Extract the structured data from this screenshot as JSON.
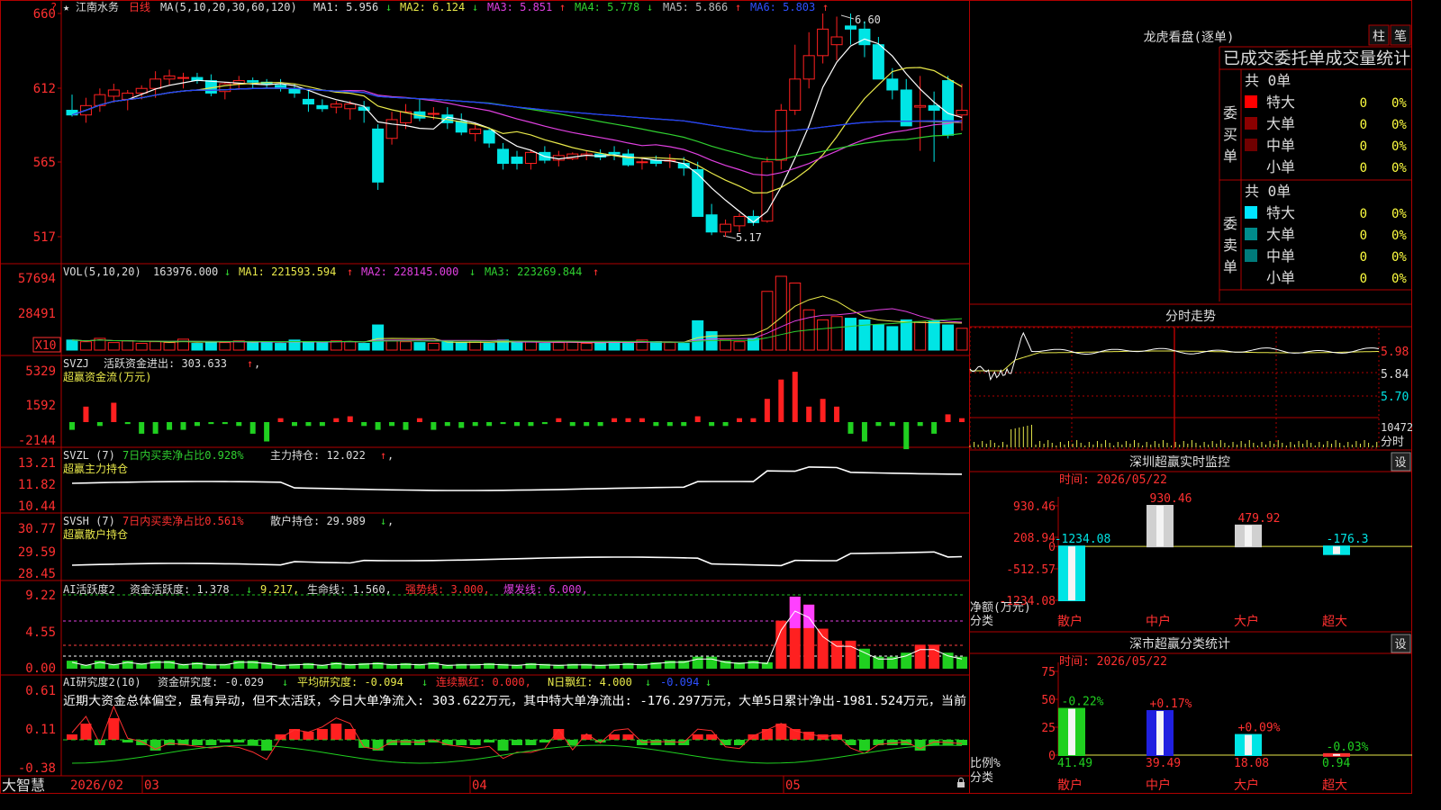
{
  "colors": {
    "up": "#ff2020",
    "down": "#00e5e5",
    "frame": "#b00000",
    "text": "#dcdcdc",
    "ma1": "#ffffff",
    "ma2": "#e8e84a",
    "ma3": "#e040e0",
    "ma4": "#30d030",
    "ma5": "#8c8c8c",
    "ma6": "#2040ff"
  },
  "main": {
    "icon": "star-icon",
    "star": "★",
    "name": "江南水务",
    "period": "日线",
    "ma_title": "MA(5,10,20,30,60,120)",
    "ma1": "MA1: 5.956",
    "ma1_arrow": "↓",
    "ma2": "MA2: 6.124",
    "ma2_arrow": "↓",
    "ma3": "MA3: 5.851",
    "ma3_arrow": "↑",
    "ma4": "MA4: 5.778",
    "ma4_arrow": "↓",
    "ma5": "MA5: 5.866",
    "ma5_arrow": "↑",
    "ma6": "MA6: 5.803",
    "ma6_arrow": "↑",
    "high_label": "6.60",
    "low_label": "5.17",
    "y_ticks": [
      "660",
      "612",
      "565",
      "517"
    ],
    "corner_marker": "?"
  },
  "vol": {
    "title": "VOL(5,10,20)",
    "value": "163976.000",
    "value_arrow": "↓",
    "ma1": "MA1: 221593.594",
    "ma1_arrow": "↑",
    "ma2": "MA2: 228145.000",
    "ma2_arrow": "↓",
    "ma3": "MA3: 223269.844",
    "ma3_arrow": "↑",
    "y_ticks": [
      "57694",
      "28491"
    ],
    "unit": "X10"
  },
  "svzj": {
    "title": "SVZJ",
    "line": "活跃资金进出: 303.633",
    "arrow": "↑",
    "comma": ",",
    "subtitle": "超赢资金流(万元)",
    "y_ticks": [
      "5329",
      "1592",
      "-2144"
    ]
  },
  "svzl": {
    "title": "SVZL (7)",
    "ratio": "7日内买卖净占比0.928%",
    "hold": "主力持仓: 12.022",
    "arrow": "↑",
    "comma": ",",
    "subtitle": "超赢主力持仓",
    "y_ticks": [
      "13.21",
      "11.82",
      "10.44"
    ]
  },
  "svsh": {
    "title": "SVSH (7)",
    "ratio": "7日内买卖净占比0.561%",
    "hold": "散户持仓: 29.989",
    "arrow": "↓",
    "comma": ",",
    "subtitle": "超赢散户持仓",
    "y_ticks": [
      "30.77",
      "29.59",
      "28.45"
    ]
  },
  "ai": {
    "title": "AI活跃度2",
    "active": "资金活跃度: 1.378",
    "active_arrow": "↓",
    "val2": "9.217,",
    "life": "生命线: 1.560,",
    "strong": "强势线: 3.000,",
    "burst": "爆发线: 6.000,",
    "y_ticks": [
      "9.22",
      "4.55",
      "0.00"
    ]
  },
  "research": {
    "title": "AI研究度2(10)",
    "val": "资金研究度: -0.029",
    "val_arrow": "↓",
    "avg": "平均研究度: -0.094",
    "avg_arrow": "↓",
    "red": "连续飘红: 0.000,",
    "nred": "N日飘红: 4.000",
    "nred_arrow": "↓",
    "last": "-0.094",
    "last_arrow": "↓",
    "comment": "近期大资金总体偏空，虽有异动，但不太活跃，今日大单净流入: 303.622万元，其中特大单净流出: -176.297万元，大单5日累计净出-1981.524万元，当前",
    "y_ticks": [
      "0.61",
      "0.11",
      "-0.38"
    ]
  },
  "xaxis": {
    "brand": "大智慧",
    "labels": [
      "2026/02",
      "03",
      "04",
      "05"
    ]
  },
  "lhb": {
    "title": "龙虎看盘(逐单)",
    "tab1": "柱",
    "tab2": "笔",
    "subtitle": "已成交委托单成交量统计",
    "buy": {
      "side": "委买单",
      "total": "共 0单",
      "rows": [
        {
          "label": "特大",
          "n": "0",
          "pct": "0%",
          "color": "#ff0000"
        },
        {
          "label": "大单",
          "n": "0",
          "pct": "0%",
          "color": "#8b0000"
        },
        {
          "label": "中单",
          "n": "0",
          "pct": "0%",
          "color": "#700000"
        },
        {
          "label": "小单",
          "n": "0",
          "pct": "0%",
          "color": ""
        }
      ]
    },
    "sell": {
      "side": "委卖单",
      "total": "共 0单",
      "rows": [
        {
          "label": "特大",
          "n": "0",
          "pct": "0%",
          "color": "#00e5ff"
        },
        {
          "label": "大单",
          "n": "0",
          "pct": "0%",
          "color": "#008b8b"
        },
        {
          "label": "中单",
          "n": "0",
          "pct": "0%",
          "color": "#007a7a"
        },
        {
          "label": "小单",
          "n": "0",
          "pct": "0%",
          "color": ""
        }
      ]
    }
  },
  "minute": {
    "title": "分时走势",
    "y_ticks": [
      "5.98",
      "5.84",
      "5.70"
    ],
    "vol_tick": "10472",
    "bottom": "分时"
  },
  "monitor": {
    "title": "深圳超赢实时监控",
    "btn": "设",
    "time": "时间: 2026/05/22",
    "y_ticks": [
      "930.46",
      "208.94",
      "0",
      "-512.57",
      "-1234.08"
    ],
    "ylabel": "净额(万元)",
    "xlabel": "分类",
    "chart_data": {
      "type": "bar",
      "categories": [
        "散户",
        "中户",
        "大户",
        "超大"
      ],
      "values": [
        -1234.08,
        930.46,
        479.92,
        -176.3
      ],
      "value_labels": [
        "-1234.08",
        "930.46",
        "479.92",
        "-176.3"
      ],
      "ylim": [
        -1234.08,
        930.46
      ]
    }
  },
  "classify": {
    "title": "深市超赢分类统计",
    "btn": "设",
    "time": "时间: 2026/05/22",
    "y_ticks": [
      "75",
      "50",
      "25",
      "0"
    ],
    "ylabel": "比例%",
    "xlabel": "分类",
    "chart_data": {
      "type": "bar",
      "categories": [
        "散户",
        "中户",
        "大户",
        "超大"
      ],
      "values": [
        41.49,
        39.49,
        18.08,
        0.94
      ],
      "changes": [
        "-0.22%",
        "+0.17%",
        "+0.09%",
        "-0.03%"
      ],
      "value_labels": [
        "41.49",
        "39.49",
        "18.08",
        "0.94"
      ],
      "ylim": [
        0,
        75
      ]
    }
  },
  "kline": {
    "ohlc": [
      [
        598,
        608,
        594,
        595
      ],
      [
        595,
        606,
        590,
        601
      ],
      [
        601,
        612,
        597,
        608
      ],
      [
        607,
        615,
        603,
        611
      ],
      [
        605,
        611,
        598,
        609
      ],
      [
        609,
        614,
        605,
        612
      ],
      [
        612,
        623,
        606,
        618
      ],
      [
        618,
        624,
        614,
        620
      ],
      [
        619,
        622,
        612,
        619
      ],
      [
        619,
        622,
        615,
        617
      ],
      [
        617,
        621,
        607,
        609
      ],
      [
        610,
        616,
        605,
        615
      ],
      [
        615,
        620,
        611,
        617
      ],
      [
        617,
        619,
        612,
        616
      ],
      [
        616,
        618,
        612,
        615
      ],
      [
        614,
        618,
        610,
        612
      ],
      [
        612,
        615,
        606,
        609
      ],
      [
        605,
        611,
        597,
        602
      ],
      [
        601,
        605,
        597,
        599
      ],
      [
        600,
        604,
        596,
        602
      ],
      [
        599,
        604,
        592,
        602
      ],
      [
        600,
        604,
        590,
        598
      ],
      [
        586,
        589,
        547,
        552
      ],
      [
        580,
        597,
        576,
        592
      ],
      [
        590,
        602,
        586,
        597
      ],
      [
        597,
        605,
        591,
        593
      ],
      [
        596,
        600,
        592,
        596
      ],
      [
        595,
        600,
        586,
        590
      ],
      [
        591,
        596,
        582,
        584
      ],
      [
        583,
        590,
        578,
        586
      ],
      [
        585,
        587,
        574,
        577
      ],
      [
        573,
        577,
        560,
        564
      ],
      [
        568,
        572,
        560,
        564
      ],
      [
        564,
        573,
        560,
        571
      ],
      [
        571,
        575,
        564,
        566
      ],
      [
        566,
        572,
        562,
        569
      ],
      [
        567,
        571,
        566,
        570
      ],
      [
        569,
        572,
        566,
        570
      ],
      [
        570,
        573,
        566,
        568
      ],
      [
        571,
        575,
        566,
        570
      ],
      [
        570,
        573,
        562,
        563
      ],
      [
        565,
        568,
        560,
        565
      ],
      [
        566,
        569,
        562,
        564
      ],
      [
        566,
        570,
        561,
        566
      ],
      [
        564,
        568,
        556,
        561
      ],
      [
        560,
        565,
        530,
        530
      ],
      [
        531,
        538,
        518,
        520
      ],
      [
        520,
        528,
        517,
        525
      ],
      [
        524,
        532,
        520,
        530
      ],
      [
        530,
        534,
        524,
        526
      ],
      [
        527,
        568,
        526,
        565
      ],
      [
        566,
        602,
        560,
        598
      ],
      [
        598,
        640,
        595,
        618
      ],
      [
        618,
        648,
        612,
        633
      ],
      [
        633,
        660,
        628,
        650
      ],
      [
        640,
        658,
        630,
        645
      ],
      [
        652,
        660,
        640,
        650
      ],
      [
        650,
        655,
        632,
        640
      ],
      [
        640,
        645,
        618,
        618
      ],
      [
        618,
        625,
        605,
        611
      ],
      [
        611,
        618,
        588,
        588
      ],
      [
        600,
        620,
        572,
        601
      ],
      [
        601,
        610,
        565,
        598
      ],
      [
        617,
        620,
        580,
        582
      ],
      [
        595,
        615,
        585,
        598
      ]
    ],
    "vol": [
      12,
      10,
      14,
      9,
      11,
      8,
      10,
      9,
      13,
      8,
      10,
      9,
      11,
      10,
      9,
      8,
      12,
      10,
      9,
      11,
      10,
      8,
      30,
      11,
      10,
      9,
      8,
      10,
      9,
      11,
      8,
      12,
      9,
      10,
      8,
      9,
      10,
      8,
      9,
      10,
      8,
      12,
      10,
      9,
      8,
      35,
      22,
      12,
      10,
      14,
      70,
      88,
      80,
      48,
      36,
      40,
      38,
      36,
      30,
      28,
      36,
      34,
      35,
      30,
      26
    ],
    "svzj": [
      -2,
      4,
      -1,
      5,
      -0.5,
      -3,
      -3,
      -2,
      -2,
      -1,
      -0.5,
      -0.5,
      -1,
      -3,
      -5,
      1,
      -1,
      -1,
      -1,
      1,
      1.5,
      -1,
      -2,
      -1,
      -2,
      1,
      -2,
      -1,
      -1.5,
      -1,
      -1,
      -0.5,
      -1,
      -1,
      -0.5,
      1,
      -1,
      -1,
      -1,
      1,
      1,
      1,
      -1,
      -1,
      -1,
      1.5,
      -1,
      -1,
      1,
      1,
      6,
      11,
      13,
      4,
      6,
      4,
      -3,
      -5,
      -1,
      -1,
      -7,
      -1,
      -3,
      2,
      1
    ],
    "ai": [
      1,
      0.5,
      1,
      0.6,
      1,
      0.7,
      1,
      1,
      0.6,
      0.8,
      0.6,
      0.6,
      1,
      1,
      0.8,
      0.5,
      0.6,
      0.7,
      0.5,
      0.8,
      0.6,
      0.7,
      0.8,
      0.6,
      0.7,
      0.6,
      0.8,
      0.5,
      0.6,
      0.6,
      0.7,
      0.6,
      0.5,
      0.7,
      0.6,
      0.5,
      0.6,
      0.6,
      0.5,
      0.6,
      0.7,
      0.6,
      0.8,
      1,
      1,
      1.5,
      1.5,
      1,
      0.8,
      1,
      0.8,
      6,
      9,
      8,
      5,
      3.5,
      3.5,
      2.5,
      1.5,
      1.5,
      2,
      3,
      3,
      2,
      1.5
    ],
    "research": [
      1,
      3,
      -1,
      4,
      -0.5,
      -1,
      -2,
      -1,
      -1,
      -1,
      -1,
      -0.5,
      -0.5,
      -1,
      -2,
      1,
      2,
      1.5,
      2,
      3,
      2,
      -1.5,
      -2,
      -1,
      -1,
      -1,
      -0.5,
      -1,
      -1,
      -1,
      -0.5,
      -2,
      -1,
      -1,
      -0.5,
      2,
      -1,
      1,
      -0.5,
      1,
      1,
      -1,
      -1,
      -1,
      -1,
      1,
      1,
      -1,
      -1,
      1,
      2,
      3,
      2,
      1.5,
      1,
      1,
      -1,
      -2,
      -1,
      -1,
      -1,
      -2,
      -1,
      -1,
      -1
    ]
  }
}
